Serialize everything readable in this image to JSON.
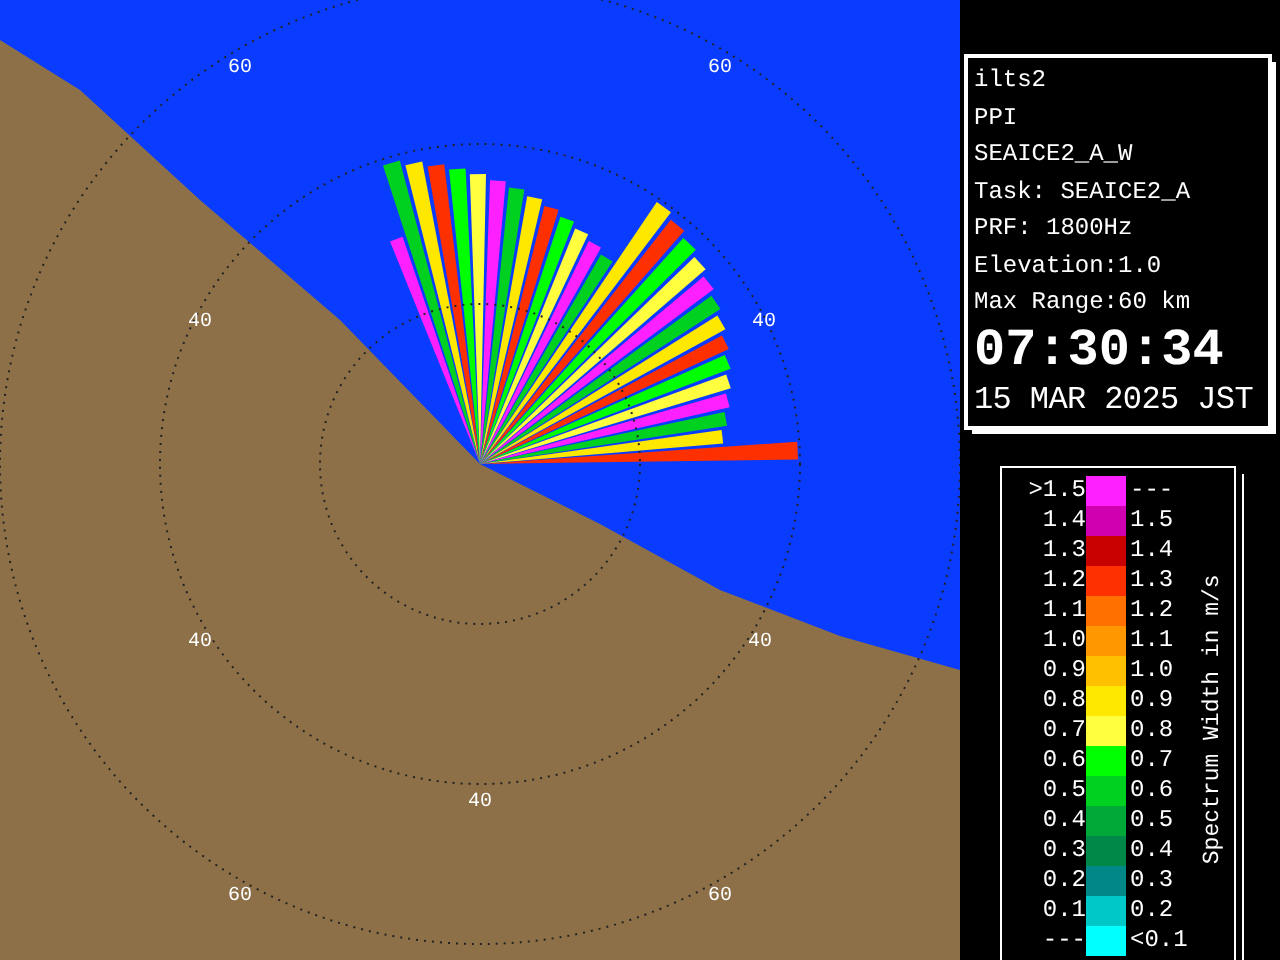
{
  "map": {
    "range_labels": [
      "60",
      "60",
      "40",
      "40",
      "40",
      "40",
      "40",
      "60",
      "60"
    ]
  },
  "info": {
    "lines": [
      "ilts2",
      "PPI",
      "SEAICE2_A_W",
      "Task: SEAICE2_A",
      "PRF: 1800Hz",
      "Elevation:1.0",
      "Max Range:60 km"
    ],
    "time": "07:30:34",
    "date": "15 MAR 2025 JST"
  },
  "legend": {
    "title": "Spectrum Width in m/s",
    "rows": [
      {
        "low": ">1.5",
        "high": "---",
        "color": "#ff20ff"
      },
      {
        "low": "1.4",
        "high": "1.5",
        "color": "#d000b0"
      },
      {
        "low": "1.3",
        "high": "1.4",
        "color": "#c80000"
      },
      {
        "low": "1.2",
        "high": "1.3",
        "color": "#ff3000"
      },
      {
        "low": "1.1",
        "high": "1.2",
        "color": "#ff7000"
      },
      {
        "low": "1.0",
        "high": "1.1",
        "color": "#ff9800"
      },
      {
        "low": "0.9",
        "high": "1.0",
        "color": "#ffc000"
      },
      {
        "low": "0.8",
        "high": "0.9",
        "color": "#ffe800"
      },
      {
        "low": "0.7",
        "high": "0.8",
        "color": "#ffff40"
      },
      {
        "low": "0.6",
        "high": "0.7",
        "color": "#00ff00"
      },
      {
        "low": "0.5",
        "high": "0.6",
        "color": "#00d020"
      },
      {
        "low": "0.4",
        "high": "0.5",
        "color": "#00a838"
      },
      {
        "low": "0.3",
        "high": "0.4",
        "color": "#008848"
      },
      {
        "low": "0.2",
        "high": "0.3",
        "color": "#008888"
      },
      {
        "low": "0.1",
        "high": "0.2",
        "color": "#00c8c8"
      },
      {
        "low": "---",
        "high": "<0.1",
        "color": "#00ffff"
      }
    ]
  }
}
